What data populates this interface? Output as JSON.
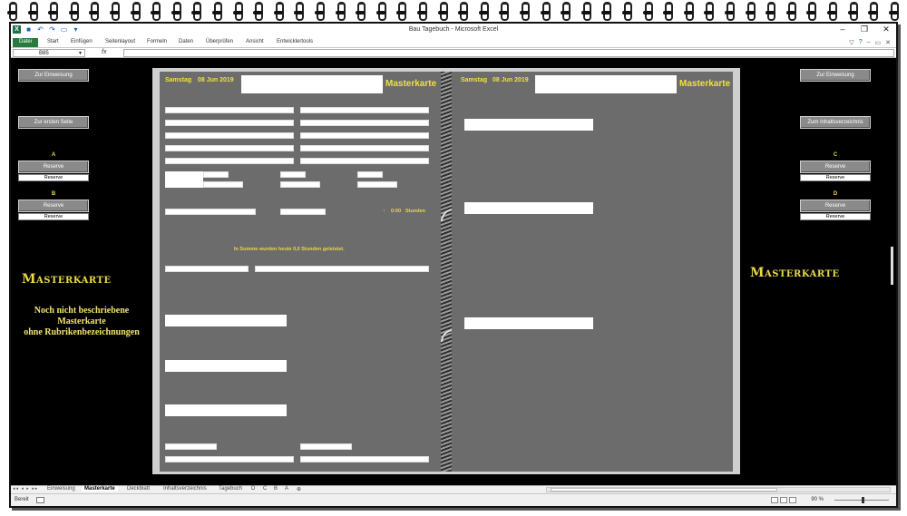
{
  "window": {
    "title": "Bau Tagebuch  -  Microsoft Excel",
    "buttons": {
      "minimize": "–",
      "restore": "❐",
      "close": "✕"
    }
  },
  "ribbon": {
    "tabs": [
      "Datei",
      "Start",
      "Einfügen",
      "Seitenlayout",
      "Formeln",
      "Daten",
      "Überprüfen",
      "Ansicht",
      "Entwicklertools"
    ]
  },
  "formula_bar": {
    "name_box": "B85",
    "fx": "fx",
    "value": ""
  },
  "left_panel": {
    "btn_intro": "Zur Einweisung",
    "btn_first": "Zur ersten Seite",
    "letter_a": "A",
    "reserve_a": "Reserve",
    "reserve_a_sub": "Reserve",
    "letter_b": "B",
    "reserve_b": "Reserve",
    "reserve_b_sub": "Reserve",
    "heading": "Masterkarte",
    "desc_l1": "Noch nicht beschriebene",
    "desc_l2": "Masterkarte",
    "desc_l3": "ohne Rubrikenbezeichnungen"
  },
  "right_panel": {
    "btn_intro": "Zur Einweisung",
    "btn_index": "Zum Inhaltsverzeichnis",
    "letter_c": "C",
    "reserve_c": "Reserve",
    "reserve_c_sub": "Reserve",
    "letter_d": "D",
    "reserve_d": "Reserve",
    "reserve_d_sub": "Reserve",
    "heading": "Masterkarte"
  },
  "left_page": {
    "day": "Samstag",
    "date": "08 Jun 2019",
    "title": "Masterkarte",
    "hours_mark": "↑",
    "hours_value": "0:00",
    "hours_unit": "Stunden",
    "summary": "In Summe wurden heute   0,0   Stunden geleistet."
  },
  "right_page": {
    "day": "Samstag",
    "date": "08 Jun 2019",
    "title": "Masterkarte"
  },
  "sheet_tabs": [
    "Einweisung",
    "Masterkarte",
    "Deckblatt",
    "Inhaltsverzeichnis",
    "Tagebuch",
    "D",
    "C",
    "B",
    "A"
  ],
  "sheet_tab_new": "⊕",
  "tab_nav": "◂◂ ◂ ▸ ▸▸",
  "status": {
    "ready": "Bereit",
    "zoom": "90 %"
  }
}
